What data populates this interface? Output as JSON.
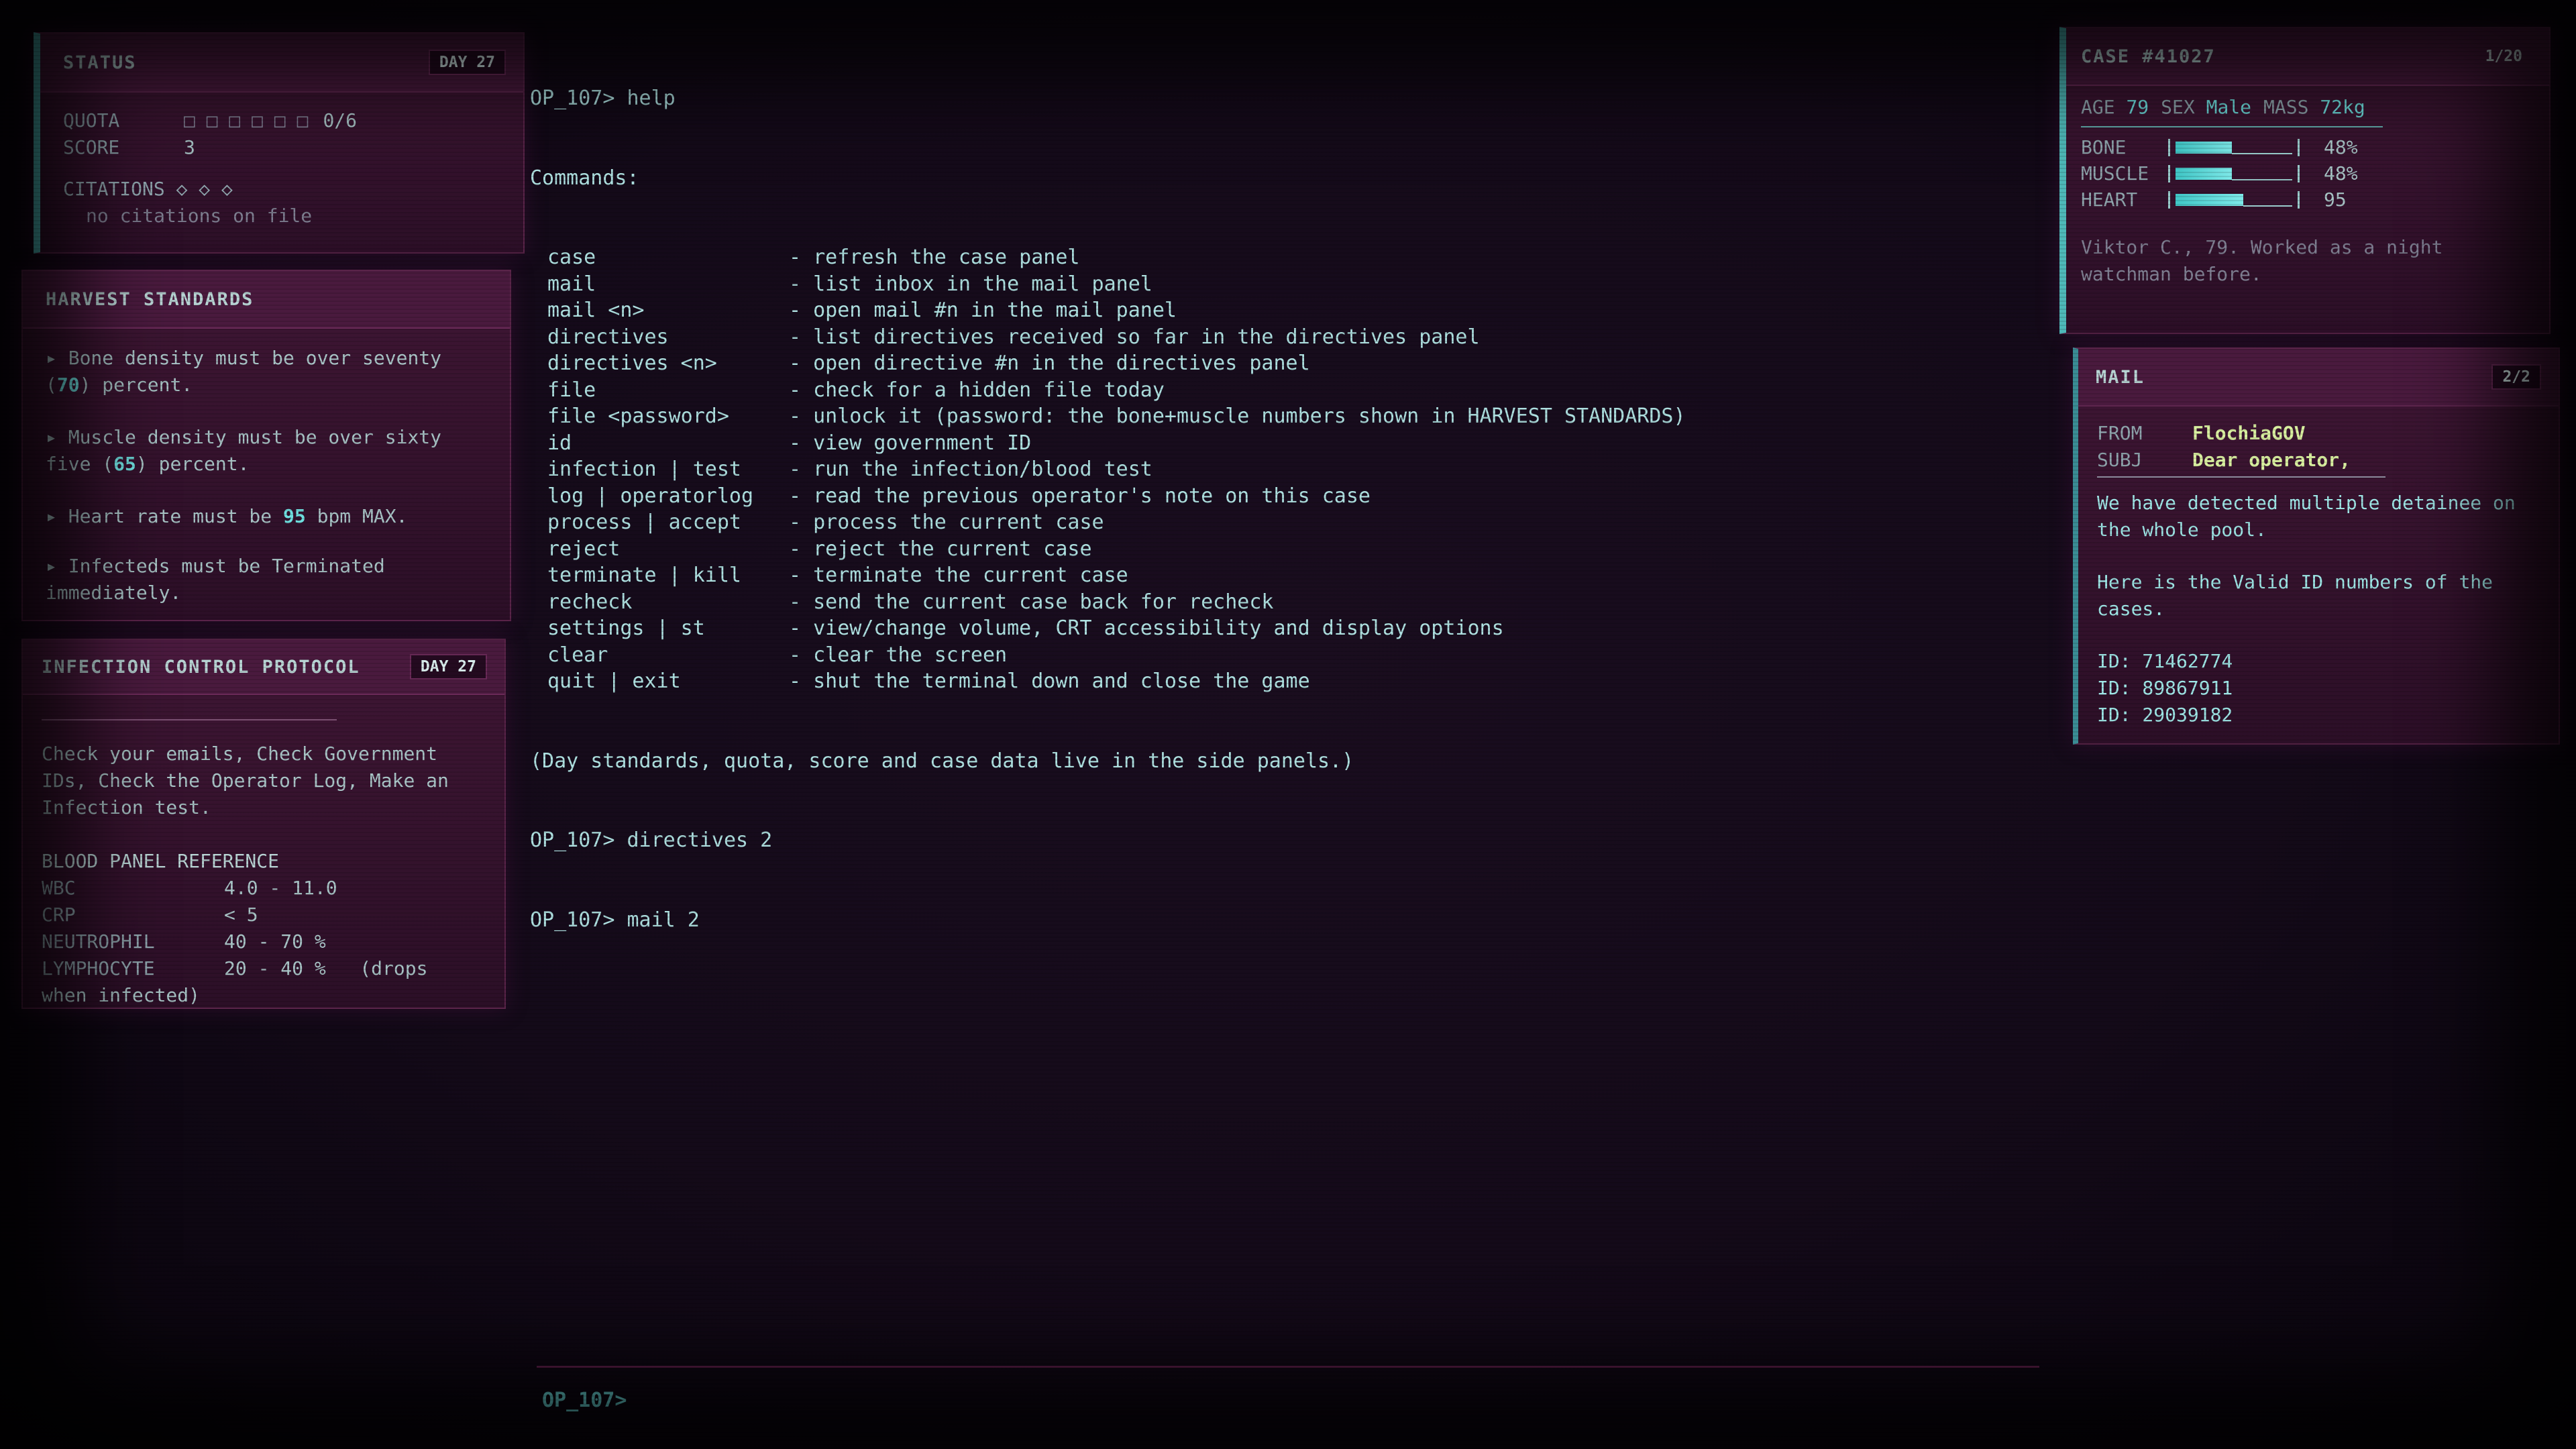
{
  "status": {
    "title": "STATUS",
    "day": "DAY 27",
    "quota_label": "QUOTA",
    "quota_boxes": "□ □ □ □ □ □",
    "quota_value": "0/6",
    "score_label": "SCORE",
    "score_value": "3",
    "citations_label": "CITATIONS ◇ ◇ ◇",
    "citations_text": "no citations on file"
  },
  "harvest": {
    "title": "HARVEST STANDARDS",
    "rules": [
      {
        "pre": "▸ Bone density must be over seventy (",
        "num": "70",
        "post": ") percent."
      },
      {
        "pre": "▸ Muscle density must be over sixty five (",
        "num": "65",
        "post": ") percent."
      },
      {
        "pre": "▸ Heart rate must be ",
        "num": "95",
        "post": " bpm MAX."
      },
      {
        "pre": "▸ Infecteds must be Terminated immediately.",
        "num": "",
        "post": ""
      }
    ]
  },
  "infection": {
    "title": "INFECTION CONTROL PROTOCOL",
    "day": "DAY 27",
    "intro": "Check your emails, Check Government IDs, Check the Operator Log, Make an Infection test.",
    "ref_title": "BLOOD PANEL REFERENCE",
    "rows": [
      {
        "name": "WBC",
        "range": "4.0 - 11.0"
      },
      {
        "name": "CRP",
        "range": "< 5"
      },
      {
        "name": "NEUTROPHIL",
        "range": "40 - 70 %"
      },
      {
        "name": "LYMPHOCYTE",
        "range": "20 - 40 %   (drops"
      }
    ],
    "tail": "when infected)"
  },
  "terminal": {
    "prompt_label": "OP_107>",
    "lines_top": [
      "OP_107> help",
      "Commands:"
    ],
    "commands": [
      {
        "cmd": "case",
        "desc": "- refresh the case panel"
      },
      {
        "cmd": "mail",
        "desc": "- list inbox in the mail panel"
      },
      {
        "cmd": "mail <n>",
        "desc": "- open mail #n in the mail panel"
      },
      {
        "cmd": "directives",
        "desc": "- list directives received so far in the directives panel"
      },
      {
        "cmd": "directives <n>",
        "desc": "- open directive #n in the directives panel"
      },
      {
        "cmd": "file",
        "desc": "- check for a hidden file today"
      },
      {
        "cmd": "file <password>",
        "desc": "- unlock it (password: the bone+muscle numbers shown in HARVEST STANDARDS)"
      },
      {
        "cmd": "id",
        "desc": "- view government ID"
      },
      {
        "cmd": "infection | test",
        "desc": "- run the infection/blood test"
      },
      {
        "cmd": "log | operatorlog",
        "desc": "- read the previous operator's note on this case"
      },
      {
        "cmd": "process | accept",
        "desc": "- process the current case"
      },
      {
        "cmd": "reject",
        "desc": "- reject the current case"
      },
      {
        "cmd": "terminate | kill",
        "desc": "- terminate the current case"
      },
      {
        "cmd": "recheck",
        "desc": "- send the current case back for recheck"
      },
      {
        "cmd": "settings | st",
        "desc": "- view/change volume, CRT accessibility and display options"
      },
      {
        "cmd": "clear",
        "desc": "- clear the screen"
      },
      {
        "cmd": "quit | exit",
        "desc": "- shut the terminal down and close the game"
      }
    ],
    "lines_bottom": [
      "(Day standards, quota, score and case data live in the side panels.)",
      "OP_107> directives 2",
      "OP_107> mail 2"
    ]
  },
  "case": {
    "title": "CASE #41027",
    "counter": "1/20",
    "age_label": "AGE",
    "age": "79",
    "sex_label": "SEX",
    "sex": "Male",
    "mass_label": "MASS",
    "mass": "72kg",
    "vitals": [
      {
        "label": "BONE",
        "value": "48%",
        "level": 0.48
      },
      {
        "label": "MUSCLE",
        "value": "48%",
        "level": 0.48
      },
      {
        "label": "HEART",
        "value": "95",
        "level": 0.58
      }
    ],
    "note": "Viktor C., 79. Worked as a night watchman before."
  },
  "mail": {
    "title": "MAIL",
    "counter": "2/2",
    "from_label": "FROM",
    "from": "FlochiaGOV",
    "subj_label": "SUBJ",
    "subj": "Dear operator,",
    "body1": "We have detected multiple detainee on the whole pool.",
    "body2": "Here is the Valid ID numbers of the cases.",
    "ids": [
      "ID: 71462774",
      "ID: 89867911",
      "ID: 29039182"
    ]
  },
  "colors": {
    "accent": "#4fb9b9",
    "panel": "#3a1430",
    "text": "#a8cfd2"
  }
}
